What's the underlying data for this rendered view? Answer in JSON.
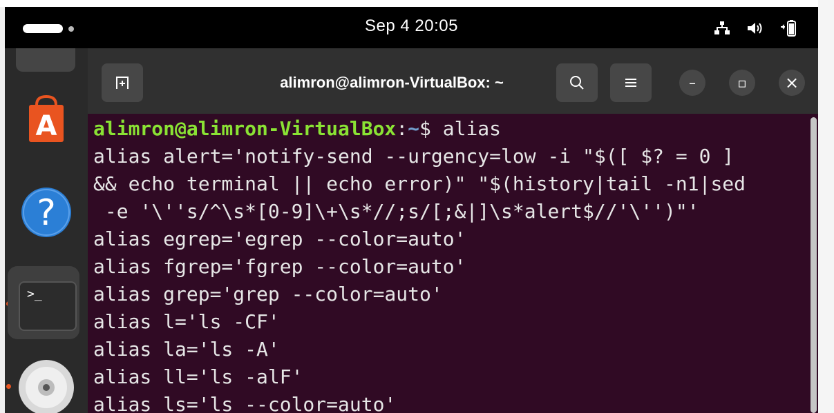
{
  "topbar": {
    "clock": "Sep 4  20:05",
    "icons": [
      "activities-indicator",
      "network-icon",
      "volume-icon",
      "battery-icon"
    ]
  },
  "dock": {
    "items": [
      {
        "name": "app-center",
        "icon": "shopping-bag-icon",
        "color": "#e95420"
      },
      {
        "name": "help",
        "icon": "question-icon",
        "label": "?",
        "color": "#2b7fd6"
      },
      {
        "name": "terminal",
        "icon": "terminal-icon",
        "label": ">_",
        "running": true
      },
      {
        "name": "disc",
        "icon": "cd-icon",
        "running": true
      }
    ]
  },
  "window": {
    "title": "alimron@alimron-VirtualBox: ~",
    "new_tab_icon": "new-tab-icon",
    "search_icon": "search-icon",
    "menu_icon": "hamburger-icon",
    "minimize_label": "–",
    "maximize_label": "▫",
    "close_label": "×"
  },
  "terminal": {
    "prompt_user": "alimron@alimron-VirtualBox",
    "prompt_colon": ":",
    "prompt_path": "~",
    "prompt_symbol": "$ ",
    "command": "alias",
    "output": [
      "alias alert='notify-send --urgency=low -i \"$([ $? = 0 ]",
      "&& echo terminal || echo error)\" \"$(history|tail -n1|sed",
      " -e '\\''s/^\\s*[0-9]\\+\\s*//;s/[;&|]\\s*alert$//'\\'')\"'",
      "alias egrep='egrep --color=auto'",
      "alias fgrep='fgrep --color=auto'",
      "alias grep='grep --color=auto'",
      "alias l='ls -CF'",
      "alias la='ls -A'",
      "alias ll='ls -alF'",
      "alias ls='ls --color=auto'"
    ],
    "colors": {
      "background": "#300a24",
      "user": "#8ae234",
      "path": "#729fcf",
      "text": "#e6e6e6"
    }
  }
}
